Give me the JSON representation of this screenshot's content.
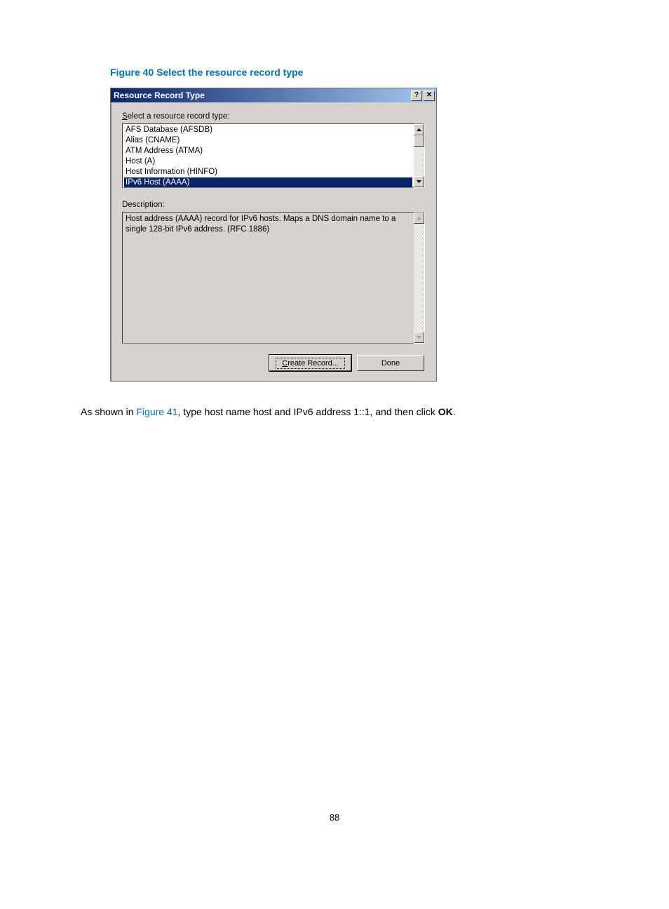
{
  "figure_caption": "Figure 40 Select the resource record type",
  "dialog": {
    "title": "Resource Record Type",
    "select_label_pre": "S",
    "select_label_post": "elect a resource record type:",
    "list_items": [
      "AFS Database (AFSDB)",
      "Alias (CNAME)",
      "ATM Address (ATMA)",
      "Host (A)",
      "Host Information (HINFO)",
      "IPv6 Host (AAAA)"
    ],
    "selected_item": "IPv6 Host (AAAA)",
    "description_label": "Description:",
    "description_text": "Host address (AAAA) record for IPv6 hosts. Maps a DNS domain name to a single 128-bit IPv6 address. (RFC 1886)",
    "create_button_pre": "C",
    "create_button_post": "reate Record...",
    "done_button": "Done"
  },
  "body": {
    "pre": "As shown in ",
    "link": "Figure 41",
    "mid": ", type host name host and IPv6 address 1::1, and then click ",
    "bold": "OK",
    "post": "."
  },
  "page_number": "88"
}
